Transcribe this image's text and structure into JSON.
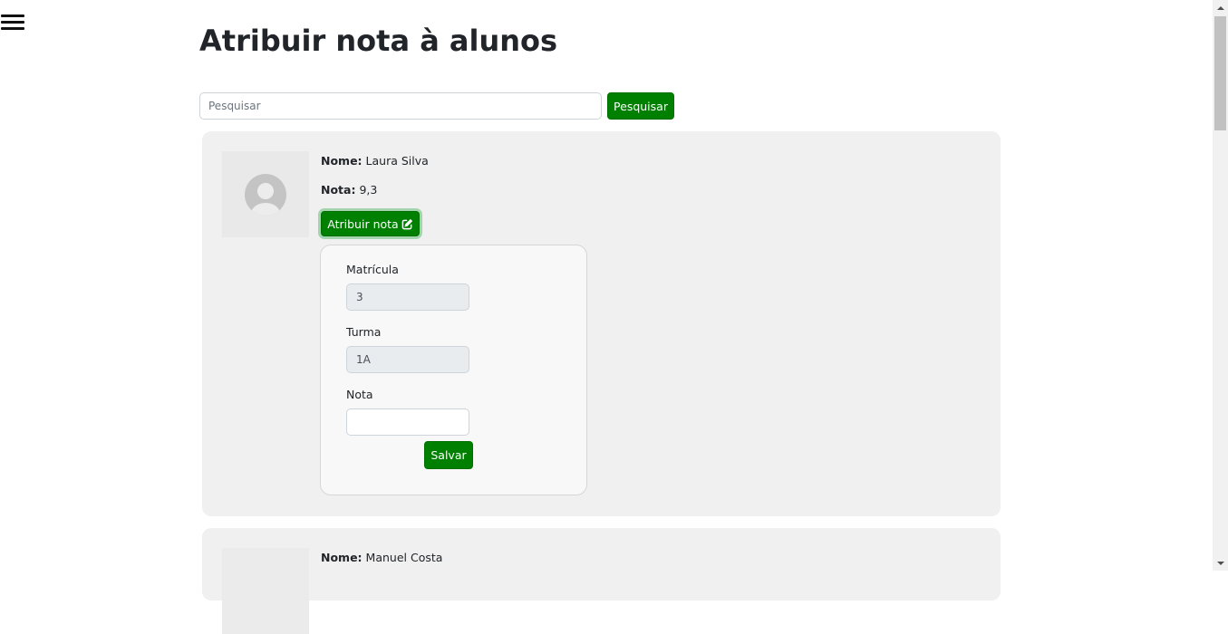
{
  "header": {
    "title": "Atribuir nota à alunos"
  },
  "search": {
    "placeholder": "Pesquisar",
    "value": "",
    "button_label": "Pesquisar"
  },
  "students": [
    {
      "name_label": "Nome:",
      "name": "Laura Silva",
      "grade_label": "Nota:",
      "grade": "9,3",
      "assign_label": "Atribuir nota",
      "form": {
        "matricula_label": "Matrícula",
        "matricula_value": "3",
        "turma_label": "Turma",
        "turma_value": "1A",
        "nota_label": "Nota",
        "nota_value": "",
        "save_label": "Salvar"
      }
    },
    {
      "name_label": "Nome:",
      "name": "Manuel Costa"
    }
  ],
  "colors": {
    "accent": "#008000",
    "card_bg": "#f0f0f0",
    "panel_bg": "#f8f8f8",
    "readonly_bg": "#e9ecef"
  },
  "icons": {
    "menu": "hamburger-menu-icon",
    "avatar": "user-avatar-icon",
    "edit": "pen-to-square-icon"
  }
}
